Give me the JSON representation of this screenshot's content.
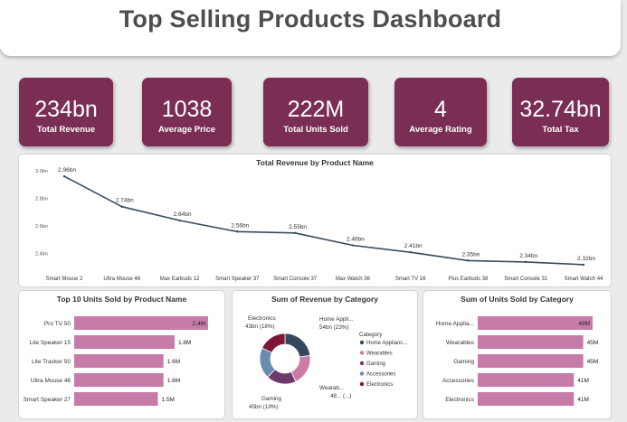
{
  "header": {
    "title": "Top Selling Products Dashboard"
  },
  "kpis": [
    {
      "value": "234bn",
      "label": "Total Revenue"
    },
    {
      "value": "1038",
      "label": "Average Price"
    },
    {
      "value": "222M",
      "label": "Total Units Sold"
    },
    {
      "value": "4",
      "label": "Average Rating"
    },
    {
      "value": "32.74bn",
      "label": "Total Tax"
    }
  ],
  "colors": {
    "kpi_bg": "#7b2e54",
    "bar": "#c77ba8",
    "line": "#3a4a5c"
  },
  "chart_data": [
    {
      "type": "line",
      "title": "Total Revenue by Product Name",
      "categories": [
        "Smart Mouse 2",
        "Ultra Mouse 46",
        "Max Earbuds 12",
        "Smart Speaker 37",
        "Smart Console 37",
        "Max Watch 36",
        "Smart TV 16",
        "Plus Earbuds 38",
        "Smart Console 31",
        "Smart Watch 44"
      ],
      "values": [
        2.96,
        2.74,
        2.64,
        2.56,
        2.55,
        2.46,
        2.41,
        2.35,
        2.34,
        2.32
      ],
      "data_labels": [
        "2.96bn",
        "2.74bn",
        "2.64bn",
        "2.56bn",
        "2.55bn",
        "2.46bn",
        "2.41bn",
        "2.35bn",
        "2.34bn",
        "2.32bn"
      ],
      "y_ticks": [
        "3.0bn",
        "2.8bn",
        "2.6bn",
        "2.4bn"
      ],
      "ylim": [
        2.3,
        3.0
      ]
    },
    {
      "type": "bar",
      "title": "Top 10 Units Sold by Product Name",
      "categories": [
        "Pro TV 50",
        "Lite Speaker 15",
        "Lite Tracker 50",
        "Ultra Mouse 46",
        "Smart Speaker 27"
      ],
      "values": [
        2.4,
        1.8,
        1.6,
        1.6,
        1.5
      ],
      "data_labels": [
        "2.4M",
        "1.8M",
        "1.6M",
        "1.6M",
        "1.5M"
      ],
      "xlim": [
        0,
        2.4
      ]
    },
    {
      "type": "pie",
      "title": "Sum of Revenue by Category",
      "legend_title": "Category",
      "categories": [
        "Home Applianc...",
        "Wearables",
        "Gaming",
        "Accessories",
        "Electronics"
      ],
      "slices": [
        {
          "name": "Home Appliances",
          "percent": 23,
          "color": "#34495e"
        },
        {
          "name": "Wearables",
          "percent": 20,
          "color": "#cc7aa6"
        },
        {
          "name": "Gaming",
          "percent": 19,
          "color": "#6e3a6c"
        },
        {
          "name": "Accessories",
          "percent": 20,
          "color": "#6a8caf"
        },
        {
          "name": "Electronics",
          "percent": 18,
          "color": "#7d1734"
        }
      ],
      "labels": {
        "home_1": "Home Appli...",
        "home_2": "54bn (23%)",
        "wear_1": "Wearab...",
        "wear_2": "48... (...)",
        "gaming_1": "Gaming",
        "gaming_2": "45bn (19%)",
        "elec_1": "Electronics",
        "elec_2": "43bn (18%)"
      }
    },
    {
      "type": "bar",
      "title": "Sum of Units Sold by Category",
      "categories": [
        "Home Applia...",
        "Wearables",
        "Gaming",
        "Accessories",
        "Electronics"
      ],
      "values": [
        49,
        45,
        45,
        41,
        41
      ],
      "data_labels": [
        "49M",
        "45M",
        "45M",
        "41M",
        "41M"
      ],
      "xlim": [
        0,
        49
      ]
    }
  ]
}
